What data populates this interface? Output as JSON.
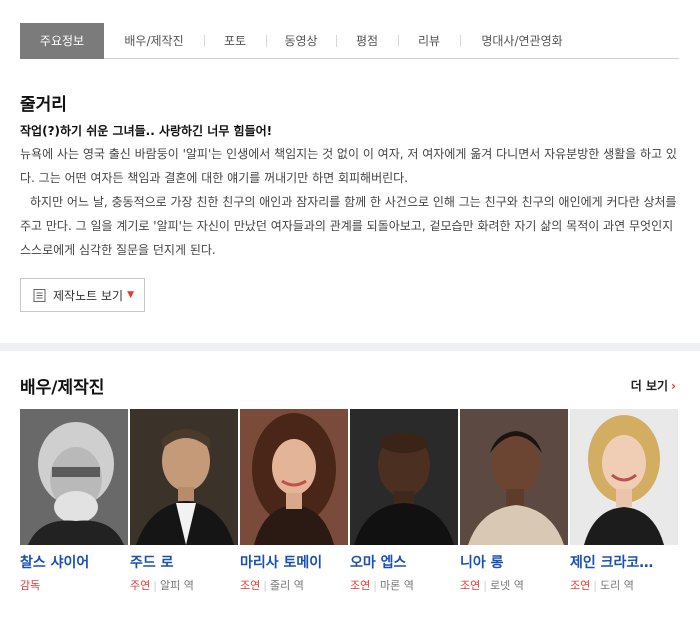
{
  "tabs": [
    {
      "label": "주요정보",
      "active": true
    },
    {
      "label": "배우/제작진"
    },
    {
      "label": "포토"
    },
    {
      "label": "동영상"
    },
    {
      "label": "평점"
    },
    {
      "label": "리뷰"
    },
    {
      "label": "명대사/연관영화"
    }
  ],
  "synopsis": {
    "title": "줄거리",
    "headline": "작업(?)하기 쉬운 그녀들.. 사랑하긴 너무 힘들어!",
    "paragraphs": [
      "뉴욕에 사는 영국 출신 바람둥이 '알피'는 인생에서 책임지는 것 없이 이 여자, 저 여자에게 옮겨 다니면서 자유분방한 생활을 하고 있다. 그는 어떤 여자든 책임과 결혼에 대한 얘기를 꺼내기만 하면 회피해버린다.",
      "하지만 어느 날, 충동적으로 가장 친한 친구의 애인과 잠자리를 함께 한 사건으로 인해 그는 친구와 친구의 애인에게 커다란 상처를 주고 만다. 그 일을 계기로 '알피'는 자신이 만났던 여자들과의 관계를 되돌아보고, 겉모습만 화려한 자기 삶의 목적이 과연 무엇인지 스스로에게 심각한 질문을 던지게 된다."
    ],
    "note_button": "제작노트 보기"
  },
  "cast": {
    "title": "배우/제작진",
    "more": "더 보기",
    "people": [
      {
        "name": "찰스 샤이어",
        "role_type": "감독",
        "character": ""
      },
      {
        "name": "주드 로",
        "role_type": "주연",
        "character": "알피 역"
      },
      {
        "name": "마리사 토메이",
        "role_type": "조연",
        "character": "줄리 역"
      },
      {
        "name": "오마 엡스",
        "role_type": "조연",
        "character": "마론 역"
      },
      {
        "name": "니아 롱",
        "role_type": "조연",
        "character": "로넷 역"
      },
      {
        "name": "제인 크라코…",
        "role_type": "조연",
        "character": "도리 역"
      }
    ]
  },
  "colors": {
    "tab_active_bg": "#7b7b7b",
    "name_link": "#1a4fb5",
    "role_accent": "#e03c31"
  }
}
